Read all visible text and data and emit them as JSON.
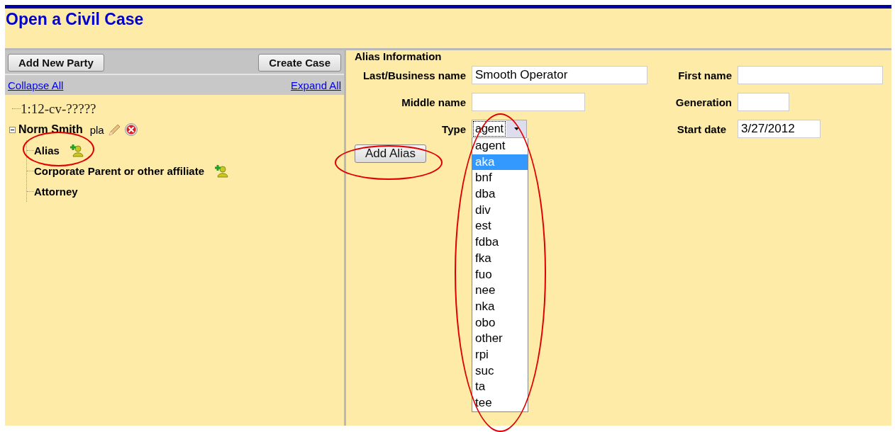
{
  "page": {
    "title": "Open a Civil Case"
  },
  "toolbar": {
    "buttons": [
      "Add New Party",
      "Create Case"
    ]
  },
  "links": [
    "Collapse All",
    "Expand All"
  ],
  "tree": {
    "case_number": "1:12-cv-?????",
    "party": {
      "name": "Norm Smith",
      "role": "pla",
      "expanded": true,
      "children": [
        {
          "label": "Alias",
          "can_add": true
        },
        {
          "label": "Corporate Parent or other affiliate",
          "can_add": true
        },
        {
          "label": "Attorney",
          "can_add": false
        }
      ]
    }
  },
  "form": {
    "heading": "Alias Information",
    "fields": [
      {
        "label": "Last/Business name",
        "value": "Smooth Operator"
      },
      {
        "label": "First name"
      },
      {
        "label": "Middle name"
      },
      {
        "label": "Generation"
      },
      {
        "label": "Type",
        "value": "agent"
      },
      {
        "label": "Start date",
        "value": "3/27/2012"
      }
    ],
    "button": "Add Alias",
    "type_options": [
      {
        "label": "agent",
        "selected": false
      },
      {
        "label": "aka",
        "selected": true
      },
      {
        "label": "bnf",
        "selected": false
      },
      {
        "label": "dba",
        "selected": false
      },
      {
        "label": "div",
        "selected": false
      },
      {
        "label": "est",
        "selected": false
      },
      {
        "label": "fdba",
        "selected": false
      },
      {
        "label": "fka",
        "selected": false
      },
      {
        "label": "fuo",
        "selected": false
      },
      {
        "label": "nee",
        "selected": false
      },
      {
        "label": "nka",
        "selected": false
      },
      {
        "label": "obo",
        "selected": false
      },
      {
        "label": "other",
        "selected": false
      },
      {
        "label": "rpi",
        "selected": false
      },
      {
        "label": "suc",
        "selected": false
      },
      {
        "label": "ta",
        "selected": false
      },
      {
        "label": "tee",
        "selected": false
      }
    ]
  }
}
